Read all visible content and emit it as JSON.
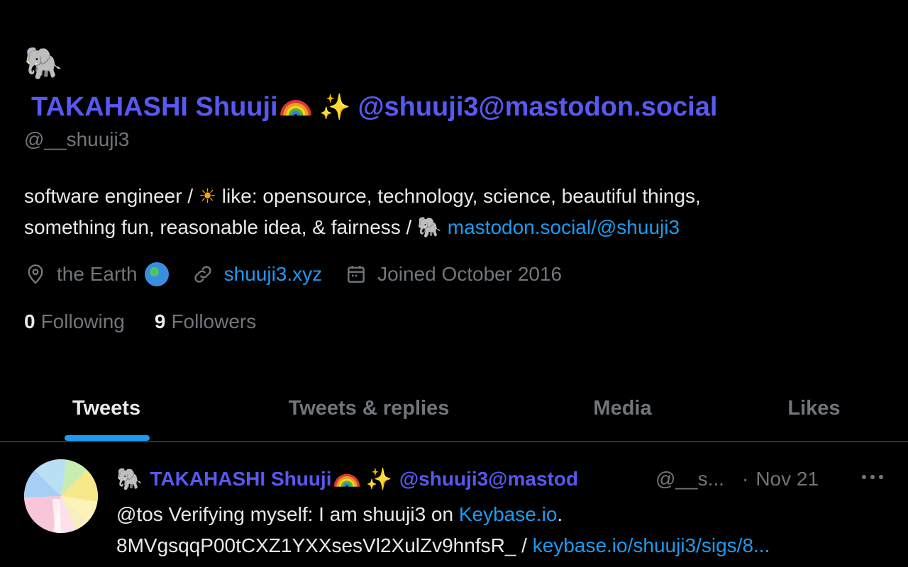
{
  "profile": {
    "display_name_text": "TAKAHASHI Shuuji",
    "display_name_handle": "@shuuji3@mastodon.social",
    "handle": "@__shuuji3",
    "bio_part1": "software engineer / ",
    "bio_part2": " like: opensource, technology, science, beautiful things,",
    "bio_part3": "something fun, reasonable idea, & fairness / ",
    "bio_link": "mastodon.social/@shuuji3",
    "location": "the Earth",
    "website": "shuuji3.xyz",
    "joined": "Joined October 2016",
    "following_count": "0",
    "following_label": "Following",
    "followers_count": "9",
    "followers_label": "Followers"
  },
  "tabs": [
    {
      "label": "Tweets",
      "active": true
    },
    {
      "label": "Tweets & replies",
      "active": false
    },
    {
      "label": "Media",
      "active": false
    },
    {
      "label": "Likes",
      "active": false
    }
  ],
  "tweet": {
    "author_name": "TAKAHASHI Shuuji",
    "author_handle_part": "@shuuji3@mastod",
    "handle": "@__s...",
    "date": "Nov 21",
    "body_line1_text": "@tos Verifying myself: I am shuuji3 on ",
    "body_line1_link": "Keybase.io",
    "body_line1_end": ".",
    "body_line2_text": "8MVgsqqP00tCXZ1YXXsesVl2XulZv9hnfsR_ / ",
    "body_line2_link": "keybase.io/shuuji3/sigs/8..."
  },
  "colors": {
    "background": "#000000",
    "accent_blue": "#1d9bf0",
    "display_name_purple": "#5858f2",
    "muted_gray": "#71767b",
    "text": "#e7e9ea"
  },
  "icons": {
    "profile_emoji": "elephant-emoji",
    "location": "location-pin-icon",
    "website": "link-icon",
    "joined": "calendar-icon",
    "more": "more-dots-icon"
  }
}
